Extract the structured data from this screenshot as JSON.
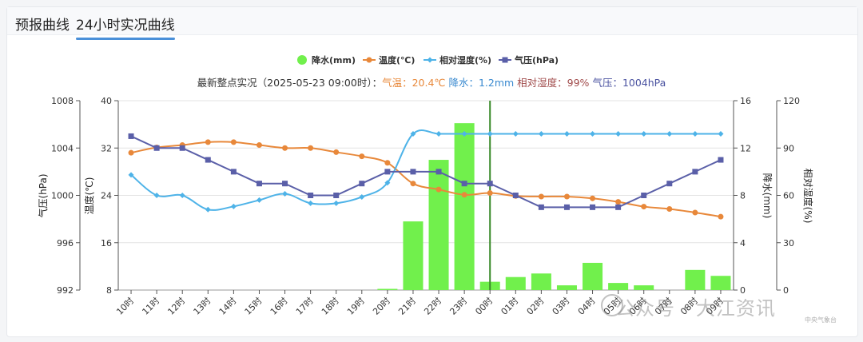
{
  "tabs": [
    {
      "label": "预报曲线",
      "active": false
    },
    {
      "label": "24小时实况曲线",
      "active": true
    }
  ],
  "watermark": {
    "text": "公众号 · 大江资讯",
    "small": "中央气象台"
  },
  "chart_data": {
    "type": "bar+line",
    "subtitle": {
      "prefix": "最新整点实况（2025-05-23 09:00时）：",
      "temp": "气温：20.4℃",
      "rain": "降水：1.2mm",
      "humidity": "相对湿度：99%",
      "pressure": "气压：1004hPa"
    },
    "categories": [
      "10时",
      "11时",
      "12时",
      "13时",
      "14时",
      "15时",
      "16时",
      "17时",
      "18时",
      "19时",
      "20时",
      "21时",
      "22时",
      "23时",
      "00时",
      "01时",
      "02时",
      "03时",
      "04时",
      "05时",
      "06时",
      "07时",
      "08时",
      "09时"
    ],
    "current_marker": "00时",
    "axes": {
      "pressure": {
        "label": "气压(hPa)",
        "range": [
          992,
          1008
        ],
        "ticks": [
          992,
          996,
          1000,
          1004,
          1008
        ]
      },
      "temperature": {
        "label": "温度(℃)",
        "range": [
          8,
          40
        ],
        "ticks": [
          8,
          16,
          24,
          32,
          40
        ]
      },
      "rain": {
        "label": "降水(mm)",
        "range": [
          0,
          16
        ],
        "ticks": [
          0,
          4,
          8,
          12,
          16
        ]
      },
      "humidity": {
        "label": "相对湿度(%)",
        "range": [
          0,
          120
        ],
        "ticks": [
          0,
          30,
          60,
          90,
          120
        ]
      }
    },
    "series": [
      {
        "name": "降水(mm)",
        "kind": "bar",
        "axis": "rain",
        "color": "#71f04c",
        "values": [
          0,
          0,
          0,
          0,
          0,
          0,
          0,
          0,
          0,
          0,
          0.1,
          5.8,
          11.0,
          14.1,
          0.7,
          1.1,
          1.4,
          0.4,
          2.3,
          0.6,
          0.4,
          0,
          1.7,
          1.2
        ]
      },
      {
        "name": "温度(℃)",
        "kind": "line",
        "axis": "temperature",
        "color": "#e8883a",
        "marker": "circle",
        "values": [
          31.2,
          32.1,
          32.5,
          33.0,
          33.0,
          32.5,
          32.0,
          32.0,
          31.3,
          30.6,
          29.5,
          26.0,
          25.0,
          24.1,
          24.4,
          23.9,
          23.8,
          23.8,
          23.5,
          22.9,
          22.1,
          21.7,
          21.1,
          20.4
        ]
      },
      {
        "name": "相对湿度(%)",
        "kind": "line",
        "axis": "humidity",
        "color": "#4eb3e8",
        "marker": "diamond",
        "values": [
          73,
          60,
          60,
          51,
          53,
          57,
          61,
          55,
          55,
          59,
          68,
          99,
          99,
          99,
          99,
          99,
          99,
          99,
          99,
          99,
          99,
          99,
          99,
          99
        ]
      },
      {
        "name": "气压(hPa)",
        "kind": "line",
        "axis": "pressure",
        "color": "#5a5fa8",
        "marker": "square",
        "values": [
          1005,
          1004,
          1004,
          1003,
          1002,
          1001,
          1001,
          1000,
          1000,
          1001,
          1002,
          1002,
          1002,
          1001,
          1001,
          1000,
          999,
          999,
          999,
          999,
          1000,
          1001,
          1002,
          1003
        ]
      }
    ],
    "legend_position": "top-center",
    "grid": true
  }
}
